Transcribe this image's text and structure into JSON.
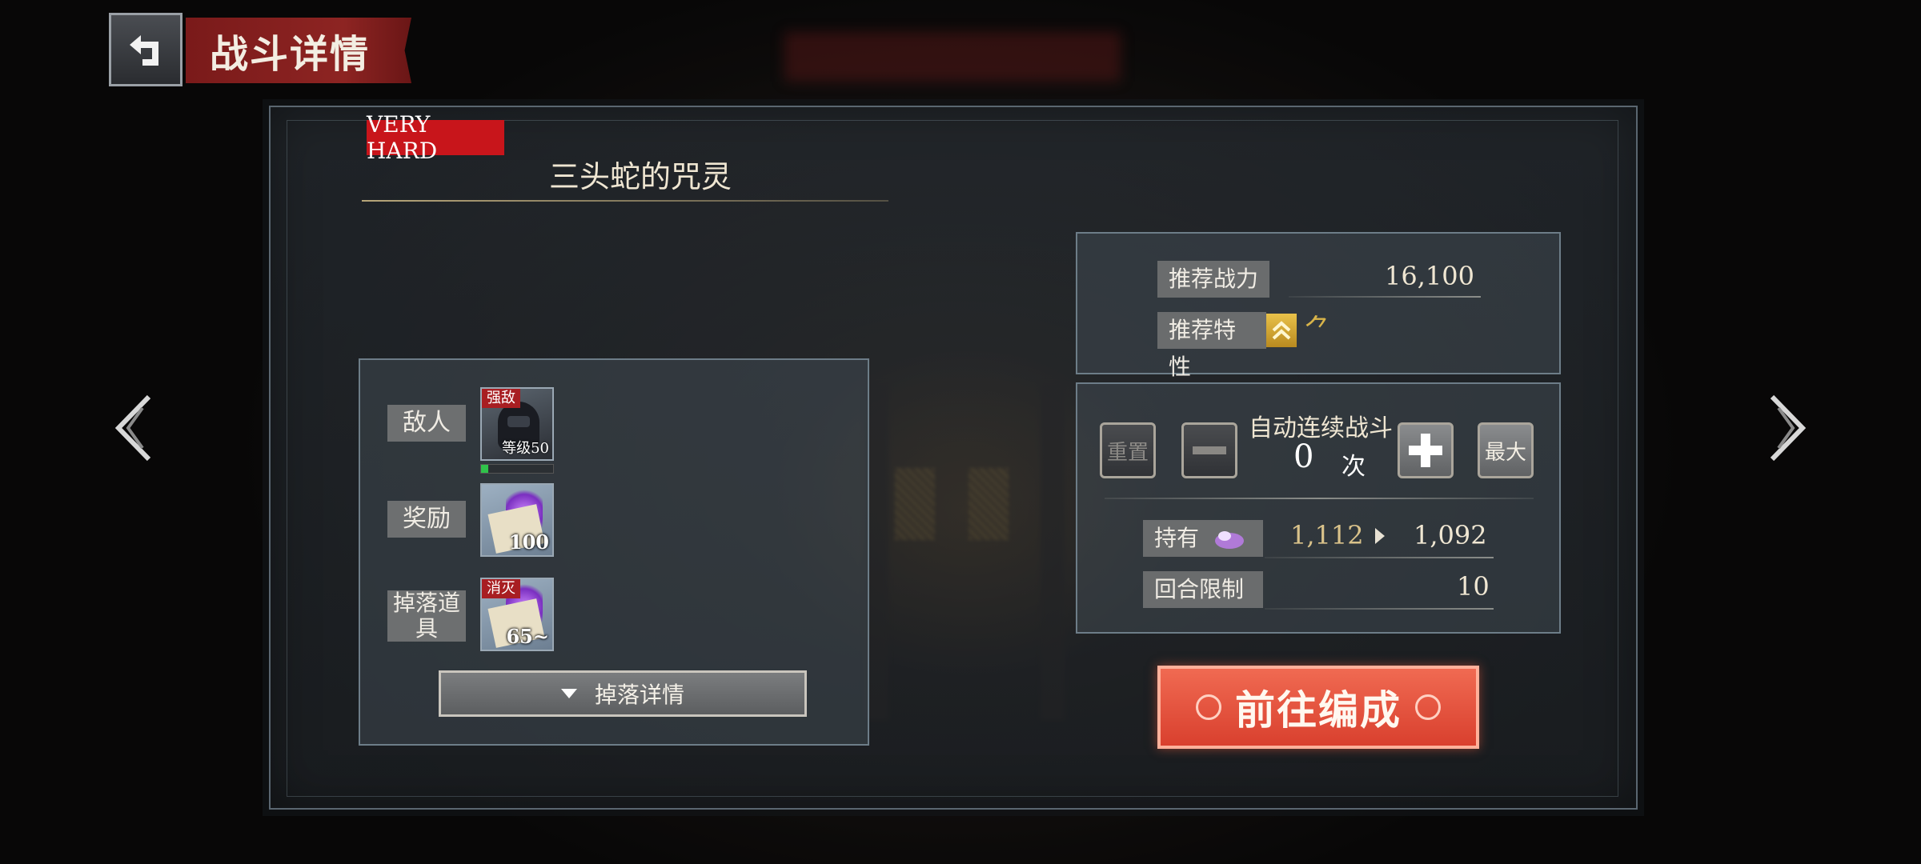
{
  "header": {
    "title": "战斗详情"
  },
  "stage": {
    "difficulty": "VERY HARD",
    "name": "三头蛇的咒灵"
  },
  "info": {
    "enemy_label": "敌人",
    "enemy_tag": "强敌",
    "enemy_level": "等级50",
    "enemy_hp_fraction": 0.1,
    "reward_label": "奖励",
    "reward_count": "100",
    "drop_label": "掉落道具",
    "drop_tag": "消灭",
    "drop_count": "65~",
    "drop_details_button": "掉落详情"
  },
  "recommend": {
    "power_label": "推荐战力",
    "power_value": "16,100",
    "trait_label": "推荐特性",
    "trait_icons": [
      "double-chevron-up-icon",
      "trait-glyph-icon"
    ],
    "trait_glyph": "⺈"
  },
  "auto_battle": {
    "reset_label": "重置",
    "label": "自动连续战斗",
    "count": "0",
    "unit": "次",
    "max_label": "最大"
  },
  "stamina": {
    "holding_label": "持有",
    "current": "1,112",
    "after": "1,092",
    "turn_limit_label": "回合限制",
    "turn_limit_value": "10"
  },
  "go_button": "前往编成",
  "colors": {
    "accent_red": "#d9402e",
    "difficulty_red": "#c8151b"
  }
}
